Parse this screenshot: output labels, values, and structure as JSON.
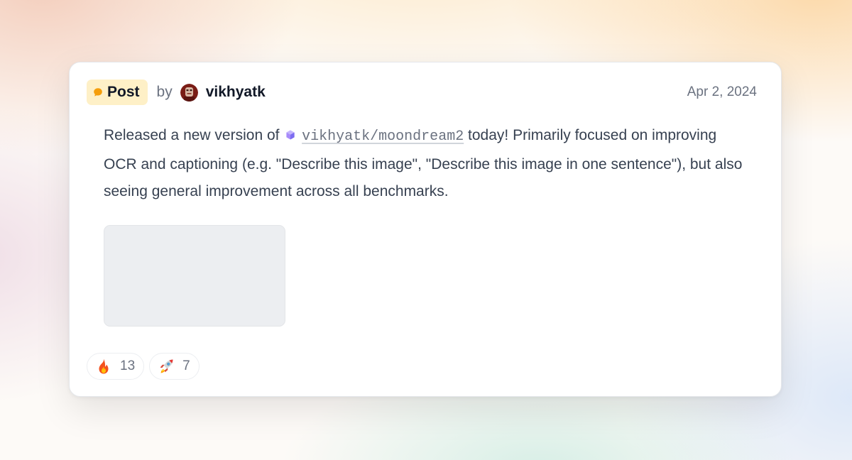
{
  "post": {
    "type_label": "Post",
    "by_label": "by",
    "author": "vikhyatk",
    "date": "Apr 2, 2024",
    "content": {
      "before_link": "Released a new version of ",
      "repo_link": "vikhyatk/moondream2",
      "after_link": " today! Primarily focused on improving OCR and captioning (e.g. \"Describe this image\", \"Describe this image in one sentence\"), but also seeing general improvement across all benchmarks."
    },
    "reactions": [
      {
        "emoji": "fire",
        "count": "13"
      },
      {
        "emoji": "rocket",
        "count": "7"
      }
    ]
  },
  "icons": {
    "badge": "chat-bubble-icon",
    "repo": "model-cube-icon"
  },
  "colors": {
    "badge_bg": "#fef0c7",
    "badge_dot": "#f59e0b",
    "repo_icon": "#8b7cf6"
  }
}
